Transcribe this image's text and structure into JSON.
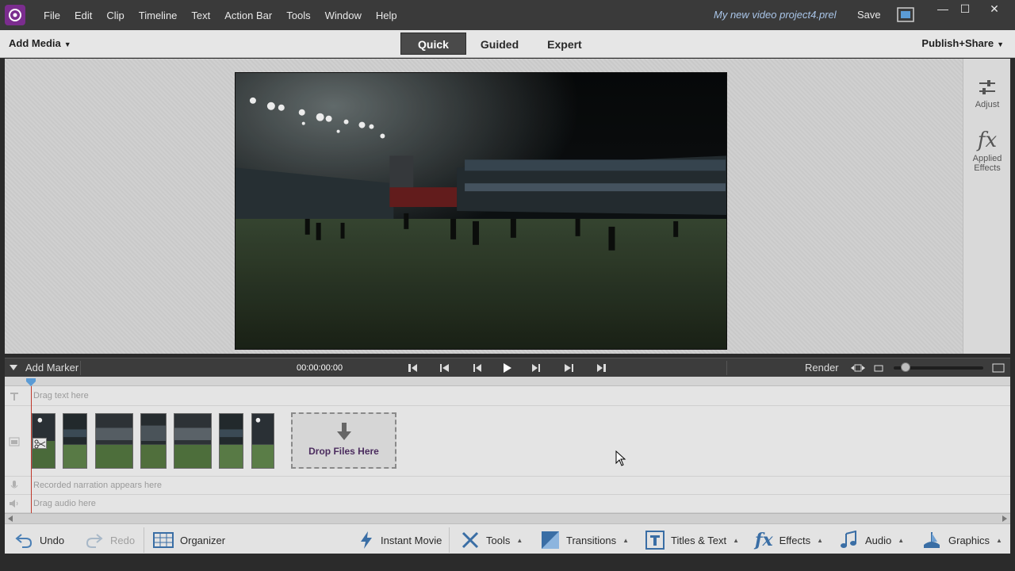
{
  "window": {
    "project_name": "My new video project4.prel",
    "save_label": "Save",
    "minimize": "—",
    "maximize": "☐",
    "close": "✕"
  },
  "menu": [
    "File",
    "Edit",
    "Clip",
    "Timeline",
    "Text",
    "Action Bar",
    "Tools",
    "Window",
    "Help"
  ],
  "modebar": {
    "add_media": "Add Media",
    "tabs": [
      "Quick",
      "Guided",
      "Expert"
    ],
    "active_tab": "Quick",
    "publish": "Publish+Share"
  },
  "right_panel": {
    "adjust": "Adjust",
    "applied_effects_1": "Applied",
    "applied_effects_2": "Effects"
  },
  "transport": {
    "add_marker": "Add Marker",
    "timecode": "00:00:00:00",
    "render": "Render"
  },
  "timeline": {
    "text_hint": "Drag text here",
    "narration_hint": "Recorded narration appears here",
    "audio_hint": "Drag audio here",
    "drop_files": "Drop Files Here"
  },
  "actionbar": {
    "undo": "Undo",
    "redo": "Redo",
    "organizer": "Organizer",
    "instant_movie": "Instant Movie",
    "tools": "Tools",
    "transitions": "Transitions",
    "titles": "Titles & Text",
    "effects": "Effects",
    "audio": "Audio",
    "graphics": "Graphics"
  },
  "colors": {
    "accent": "#7b2d8e",
    "project_name": "#a9c5e8",
    "playhead": "#c0392b"
  }
}
